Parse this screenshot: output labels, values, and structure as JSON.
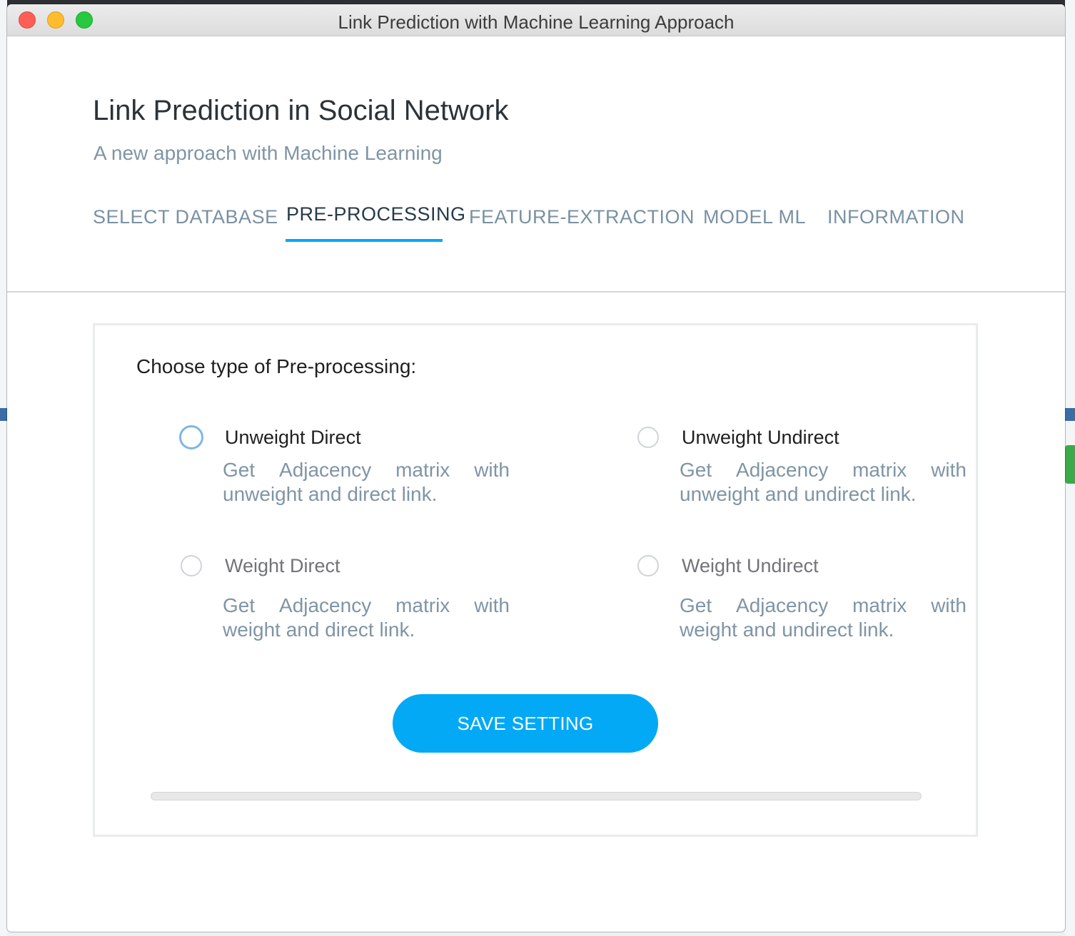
{
  "window": {
    "title": "Link Prediction with Machine Learning Approach"
  },
  "header": {
    "title": "Link Prediction in Social Network",
    "subtitle": "A new approach with Machine Learning"
  },
  "tabs": [
    {
      "label": "SELECT DATABASE",
      "active": false
    },
    {
      "label": "PRE-PROCESSING",
      "active": true
    },
    {
      "label": "FEATURE-EXTRACTION",
      "active": false
    },
    {
      "label": "MODEL ML",
      "active": false
    },
    {
      "label": "INFORMATION",
      "active": false
    }
  ],
  "panel": {
    "heading": "Choose type of Pre-processing:",
    "options": [
      {
        "label": "Unweight Direct",
        "desc_words": [
          "Get",
          "Adjacency",
          "matrix",
          "with"
        ],
        "desc_rest": "unweight and direct link.",
        "selected": false
      },
      {
        "label": "Unweight Undirect",
        "desc_words": [
          "Get",
          "Adjacency",
          "matrix",
          "with"
        ],
        "desc_rest": "unweight and undirect link.",
        "selected": false
      },
      {
        "label": "Weight Direct",
        "desc_words": [
          "Get",
          "Adjacency",
          "matrix",
          "with"
        ],
        "desc_rest": "weight and direct link.",
        "selected": false
      },
      {
        "label": "Weight Undirect",
        "desc_words": [
          "Get",
          "Adjacency",
          "matrix",
          "with"
        ],
        "desc_rest": "weight and undirect link.",
        "selected": false
      }
    ],
    "save_label": "SAVE SETTING",
    "progress": 0
  },
  "colors": {
    "accent": "#03a9f4",
    "muted_text": "#7f95a5",
    "tab_text": "#7991a3"
  }
}
